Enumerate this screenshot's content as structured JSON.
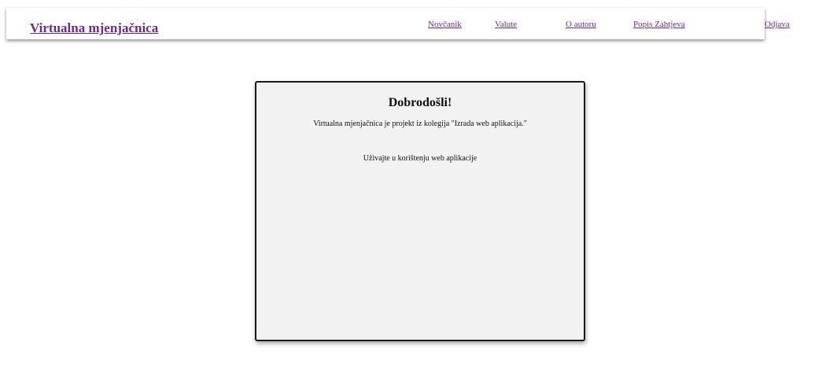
{
  "header": {
    "brand": "Virtualna mjenjačnica",
    "nav": {
      "wallet": "Novčanik",
      "currencies": "Valute",
      "about": "O autoru",
      "requests": "Popis Zahtjeva",
      "logout": "Odjava"
    }
  },
  "main": {
    "title": "Dobrodošli!",
    "description": "Virtualna mjenjačnica je projekt iz kolegija \"Izrada web aplikacija.\"",
    "message": "Uživajte u korištenju web aplikacije"
  },
  "colors": {
    "link": "#6a2a8e",
    "card_background": "#f2f2f2",
    "card_border": "#1a1a1a"
  }
}
